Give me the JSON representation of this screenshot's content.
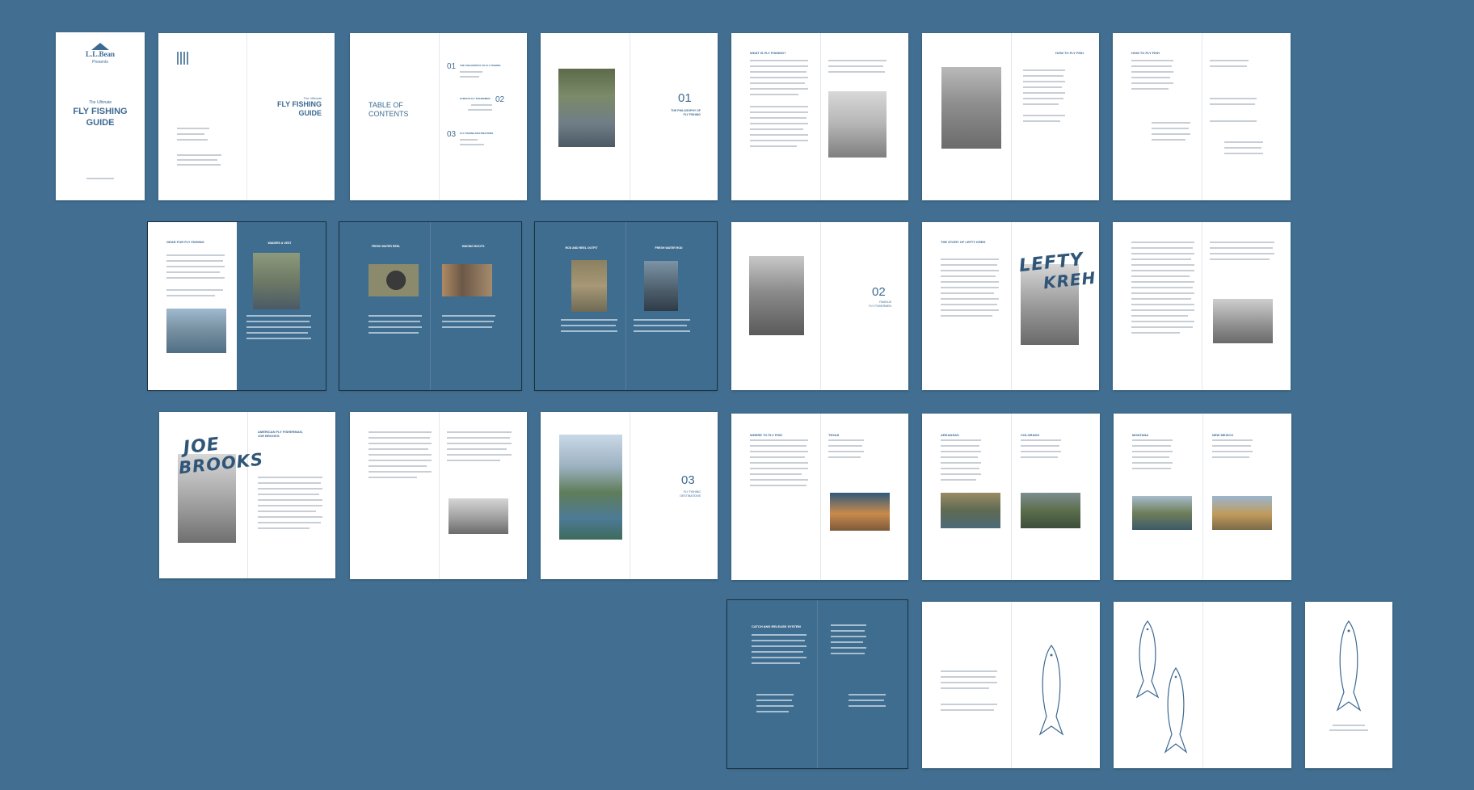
{
  "cover": {
    "brand": "L.L.Bean",
    "presents": "Presents",
    "ultimate": "The Ultimate",
    "title_line1": "FLY FISHING",
    "title_line2": "GUIDE"
  },
  "title_page": {
    "ultimate": "The Ultimate",
    "title_line1": "FLY FISHING",
    "title_line2": "GUIDE"
  },
  "toc": {
    "heading_line1": "TABLE OF",
    "heading_line2": "CONTENTS",
    "entries": [
      {
        "num": "01",
        "title": "THE PHILOSOPHY OF FLY FISHING"
      },
      {
        "num": "02",
        "title": "FAMOUS FLY FISHERMEN"
      },
      {
        "num": "03",
        "title": "FLY FISHING DESTINATIONS"
      }
    ]
  },
  "chapters": [
    {
      "num": "01",
      "line1": "THE PHILOSOPHY OF",
      "line2": "FLY FISHING"
    },
    {
      "num": "02",
      "line1": "FAMOUS",
      "line2": "FLY FISHERMEN"
    },
    {
      "num": "03",
      "line1": "FLY FISHING",
      "line2": "DESTINATIONS"
    }
  ],
  "spreads": {
    "what_is": "WHAT IS FLY FISHING?",
    "how_to_1": "HOW TO FLY FISH",
    "how_to_2": "HOW TO FLY FISH",
    "gear": "GEAR FOR FLY FISHING",
    "waders": "WADERS & VEST",
    "reel_a": "FRESH WATER REEL",
    "reel_b": "WADING BOOTS",
    "rod_a": "ROD AND REEL OUTFIT",
    "rod_b": "FRESH WATER ROD",
    "lefty": "THE STORY OF LEFTY KREH",
    "lefty_script_1": "LEFTY",
    "lefty_script_2": "KREH",
    "joe_script_1": "JOE",
    "joe_script_2": "BROOKS",
    "joe_heading": "AMERICAN FLY FISHERMAN, JOE BROOKS",
    "where": "WHERE TO FLY FISH",
    "texas": "TEXAS",
    "arkansas": "ARKANSAS",
    "colorado": "COLORADO",
    "montana": "MONTANA",
    "new_mexico": "NEW MEXICO",
    "catch_release": "CATCH AND RELEASE SYSTEM"
  }
}
